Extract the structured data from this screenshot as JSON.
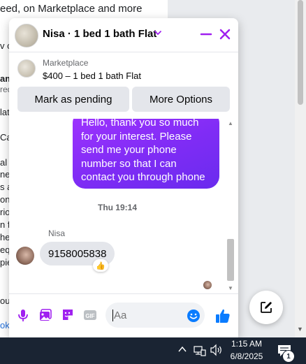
{
  "background": {
    "top_line": "eed, on Marketplace and more",
    "fragments": [
      "v o",
      "am",
      "red",
      "lat",
      "Ca",
      "al A",
      "ner",
      "s a",
      "on",
      "rio",
      "n fa",
      "hed",
      "equ",
      "pie",
      "ou",
      "ok."
    ]
  },
  "chat": {
    "title": "Nisa · 1 bed 1 bath Flat",
    "listing": {
      "source": "Marketplace",
      "title": "$400 – 1 bed 1 bath Flat"
    },
    "actions": {
      "pending_label": "Mark as pending",
      "more_label": "More Options"
    },
    "messages": {
      "outgoing_text": "Hello, thank you so much for your interest. Please send me your phone number so that I can contact you through phone",
      "timestamp": "Thu 19:14",
      "sender": "Nisa",
      "incoming_text": "9158005838",
      "reaction": "👍"
    },
    "composer": {
      "placeholder": "Aa"
    }
  },
  "colors": {
    "accent": "#a020f0",
    "like_blue": "#0a7cff",
    "outgoing_gradient_start": "#a033ff",
    "outgoing_gradient_end": "#6a2bee"
  },
  "icons": [
    "chevron-down-icon",
    "minimize-icon",
    "close-icon",
    "microphone-icon",
    "photo-icon",
    "sticker-icon",
    "gif-icon",
    "emoji-icon",
    "thumbs-up-icon",
    "compose-icon",
    "network-icon",
    "volume-icon",
    "notification-icon"
  ],
  "taskbar": {
    "time": "1:15 AM",
    "date": "6/8/2025",
    "notification_count": "1"
  }
}
